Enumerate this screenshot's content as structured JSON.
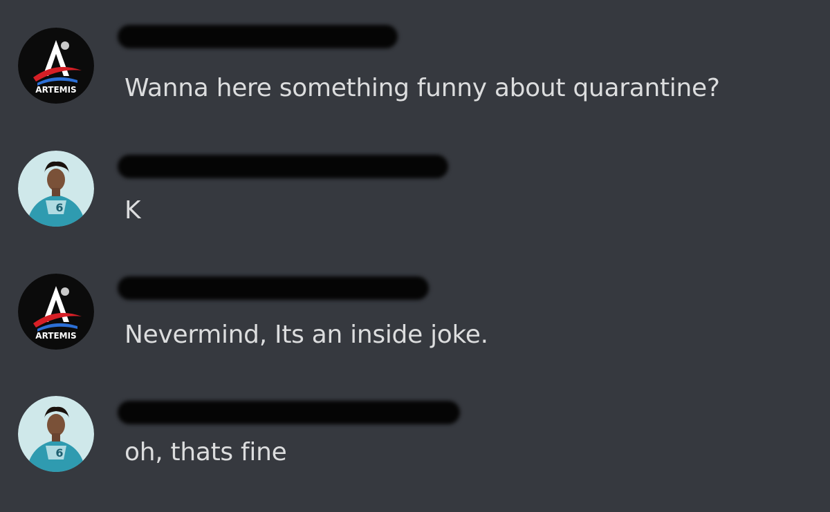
{
  "messages": [
    {
      "avatar": "artemis-logo-icon",
      "avatar_text": "ARTEMIS",
      "author": "",
      "text": "Wanna here something funny about quarantine?"
    },
    {
      "avatar": "person-avatar-icon",
      "author": "",
      "text": "K"
    },
    {
      "avatar": "artemis-logo-icon",
      "avatar_text": "ARTEMIS",
      "author": "",
      "text": "Nevermind, Its an inside joke."
    },
    {
      "avatar": "person-avatar-icon",
      "author": "",
      "text": "oh, thats fine"
    }
  ],
  "colors": {
    "background": "#36393f",
    "message_text": "#dcddde",
    "redaction": "#050505"
  }
}
